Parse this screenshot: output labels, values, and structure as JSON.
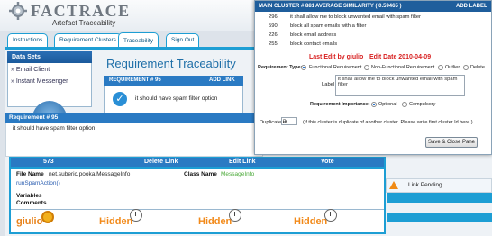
{
  "app": {
    "logo_text": "FACTRACE",
    "subtitle": "Artefact Traceability"
  },
  "tabs": [
    "Instructions",
    "Requirement Clusters",
    "Traceability",
    "Sign Out"
  ],
  "sidebar": {
    "title": "Data Sets",
    "items": [
      "Email Client",
      "Instant Messenger"
    ]
  },
  "main": {
    "title": "Requirement Traceability",
    "req_card_header": "REQUIREMENT # 95",
    "req_card_add": "ADD LINK",
    "req_card_text": "it should have spam filter option"
  },
  "req_panel": {
    "header": "Requirement # 95",
    "text": "it should have spam filter option"
  },
  "link_table": {
    "id": "573",
    "delete_label": "Delete Link",
    "edit_label": "Edit Link",
    "vote_label": "Vote",
    "file_name_label": "File Name",
    "file_name": "net.suberic.pooka.MessageInfo",
    "class_name_label": "Class Name",
    "class_name": "MessageInfo",
    "method": "runSpamAction()",
    "variables_label": "Variables",
    "comments_label": "Comments",
    "user": "giulio",
    "hidden": [
      "Hidden",
      "Hidden",
      "Hidden"
    ]
  },
  "link_pending": "Link Pending",
  "cluster_pane": {
    "header": "MAIN CLUSTER # 881",
    "similarity": "AVERAGE SIMILARITY ( 0.59465 )",
    "add_label": "ADD LABEL",
    "rows": [
      {
        "id": "296",
        "text": "it shall allow me to block unwanted email with spam filter"
      },
      {
        "id": "590",
        "text": "block all spam emails with a filter"
      },
      {
        "id": "226",
        "text": "block email address"
      },
      {
        "id": "255",
        "text": "block contact emails"
      }
    ],
    "last_edit": "Last Edit by giulio",
    "edit_date": "Edit Date 2010-04-09",
    "req_type_label": "Requirement Type:",
    "req_types": [
      "Functional Requirement",
      "Non-Functional Requirement",
      "Outlier",
      "Delete"
    ],
    "label_text": "Label",
    "textarea": "it shall allow me to block unwanted email with spam filter",
    "importance_label": "Requirement Importance:",
    "importance": [
      "Optional",
      "Compulsory"
    ],
    "duplicate_label": "Duplicate of",
    "duplicate_value": "0",
    "duplicate_help": "(If this cluster is duplicate of another cluster. Please write first cluster Id here.)",
    "save_button": "Save & Close Pane"
  }
}
